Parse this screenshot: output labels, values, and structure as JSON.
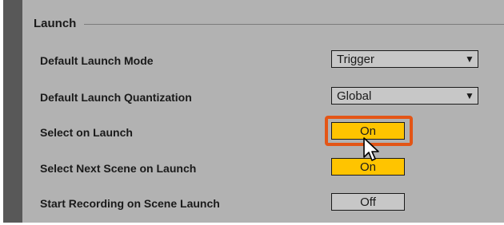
{
  "section": {
    "title": "Launch"
  },
  "settings": [
    {
      "label": "Default Launch Mode",
      "control": "dropdown",
      "value": "Trigger"
    },
    {
      "label": "Default Launch Quantization",
      "control": "dropdown",
      "value": "Global"
    },
    {
      "label": "Select on Launch",
      "control": "toggle",
      "value": "On",
      "highlighted": true
    },
    {
      "label": "Select Next Scene on Launch",
      "control": "toggle",
      "value": "On"
    },
    {
      "label": "Start Recording on Scene Launch",
      "control": "toggle",
      "value": "Off"
    }
  ],
  "colors": {
    "toggle_on": "#ffc400",
    "toggle_off": "#c7c7c7",
    "highlight_border": "#e35516",
    "panel": "#b2b2b2"
  },
  "icons": {
    "dropdown_arrow": "triangle-down-icon",
    "cursor": "mouse-pointer-icon"
  }
}
